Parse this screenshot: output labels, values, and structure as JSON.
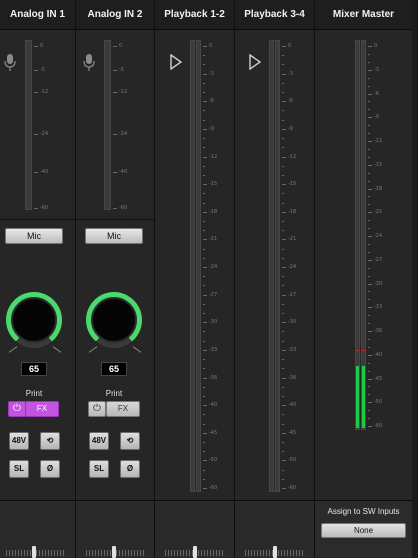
{
  "channels": [
    {
      "name": "Analog IN 1",
      "input_type": "Mic",
      "gain": "65",
      "print_label": "Print",
      "fx_label": "FX",
      "power_icon": "⏻",
      "fx_on": true,
      "phantom_label": "48V",
      "lowcut_icon": "⟲",
      "solo_label": "SL",
      "phase_label": "Ø",
      "meter_ticks": [
        "0",
        "-5",
        "-12",
        "-24",
        "-40",
        "-60"
      ]
    },
    {
      "name": "Analog IN 2",
      "input_type": "Mic",
      "gain": "65",
      "print_label": "Print",
      "fx_label": "FX",
      "power_icon": "⏻",
      "fx_on": false,
      "phantom_label": "48V",
      "lowcut_icon": "⟲",
      "solo_label": "SL",
      "phase_label": "Ø",
      "meter_ticks": [
        "0",
        "-5",
        "-12",
        "-24",
        "-40",
        "-60"
      ]
    },
    {
      "name": "Playback 1-2",
      "meter_ticks": [
        "0",
        "-3",
        "-6",
        "-9",
        "-12",
        "-15",
        "-18",
        "-21",
        "-24",
        "-27",
        "-30",
        "-33",
        "-36",
        "-40",
        "-45",
        "-50",
        "-60"
      ]
    },
    {
      "name": "Playback 3-4",
      "meter_ticks": [
        "0",
        "-3",
        "-6",
        "-9",
        "-12",
        "-15",
        "-18",
        "-21",
        "-24",
        "-27",
        "-30",
        "-33",
        "-36",
        "-40",
        "-45",
        "-50",
        "-60"
      ]
    },
    {
      "name": "Mixer Master",
      "meter_ticks": [
        "0",
        "-3",
        "-6",
        "-9",
        "-12",
        "-15",
        "-18",
        "-21",
        "-24",
        "-27",
        "-30",
        "-33",
        "-36",
        "-40",
        "-45",
        "-50",
        "-60"
      ],
      "assign_label": "Assign to SW Inputs",
      "assign_value": "None"
    }
  ],
  "master_levels": {
    "left": 0.16,
    "right": 0.16,
    "peak": 0.2
  },
  "colors": {
    "accent_fx": "#c254e0",
    "knob_ring": "#4ad96a",
    "meter_green": "#1fc94a",
    "peak_red": "#d12a2a"
  }
}
